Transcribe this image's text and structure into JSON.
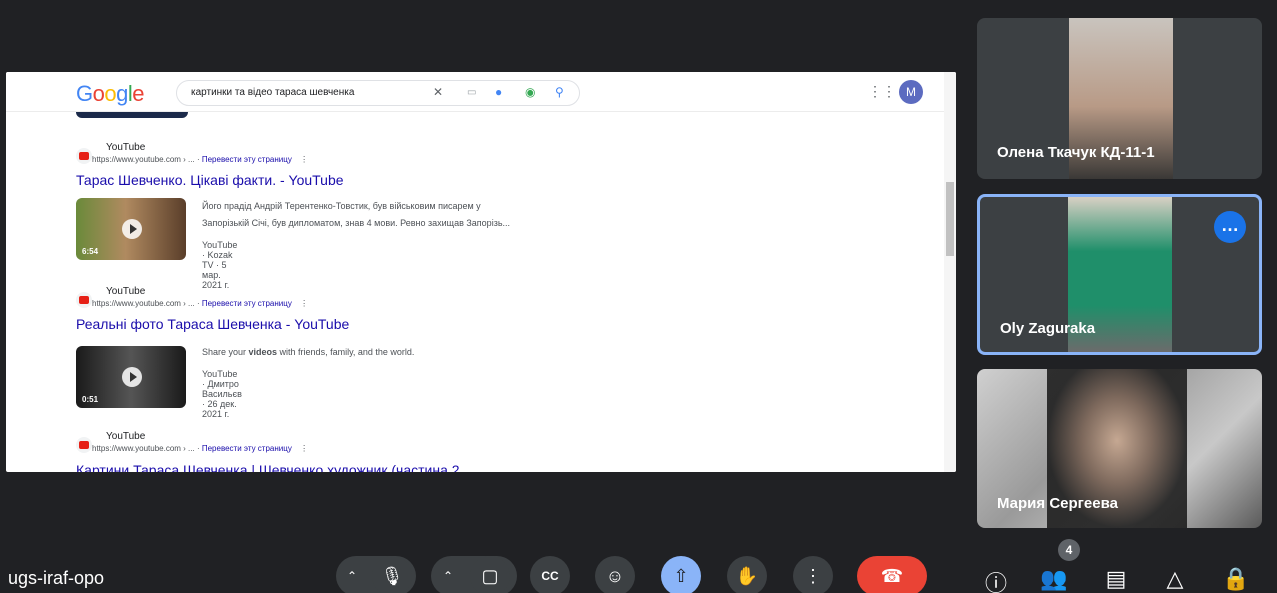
{
  "meeting": {
    "code": "ugs-iraf-opo",
    "people_count": "4"
  },
  "shared_screen": {
    "search_query": "картинки та відео тараса шевченка",
    "profile_initial": "M",
    "results": [
      {
        "site": "YouTube",
        "url": "https://www.youtube.com › ...",
        "translate": "Перевести эту страницу",
        "title": "Тарас Шевченко. Цікаві факти. - YouTube",
        "snippet_1": "Його прадід Андрій Терентенко-Товстик, був військовим писарем у",
        "snippet_2": "Запорізькій Січі, був дипломатом, знав 4 мови. Ревно захищав Запорізь...",
        "meta": "YouTube · Kozak TV · 5 мар. 2021 г.",
        "duration": "6:54"
      },
      {
        "site": "YouTube",
        "url": "https://www.youtube.com › ...",
        "translate": "Перевести эту страницу",
        "title": "Реальні фото Тараса Шевченка - YouTube",
        "snippet_pre": "Share your ",
        "snippet_bold": "videos",
        "snippet_post": " with friends, family, and the world.",
        "meta": "YouTube · Дмитро Васильєв · 26 дек. 2021 г.",
        "duration": "0:51"
      },
      {
        "site": "YouTube",
        "url": "https://www.youtube.com › ...",
        "translate": "Перевести эту страницу",
        "title": "Картини Тараса Шевченка | Шевченко художник (частина 2"
      }
    ]
  },
  "participants": [
    {
      "name": "Олена Ткачук КД-11-1"
    },
    {
      "name": "Oly Zaguraka",
      "active": true
    },
    {
      "name": "Мария Сергеева"
    }
  ],
  "colors": {
    "background": "#202124",
    "control": "#3c4043",
    "active_blue": "#8ab4f8",
    "end_call": "#ea4335",
    "link": "#1a0dab"
  },
  "icons": {
    "controls": [
      "mic-icon",
      "camera-icon",
      "captions-icon",
      "emoji-icon",
      "present-icon",
      "raise-hand-icon",
      "more-options-icon",
      "end-call-icon"
    ],
    "right": [
      "info-icon",
      "people-icon",
      "chat-icon",
      "activities-icon",
      "host-controls-icon"
    ]
  }
}
